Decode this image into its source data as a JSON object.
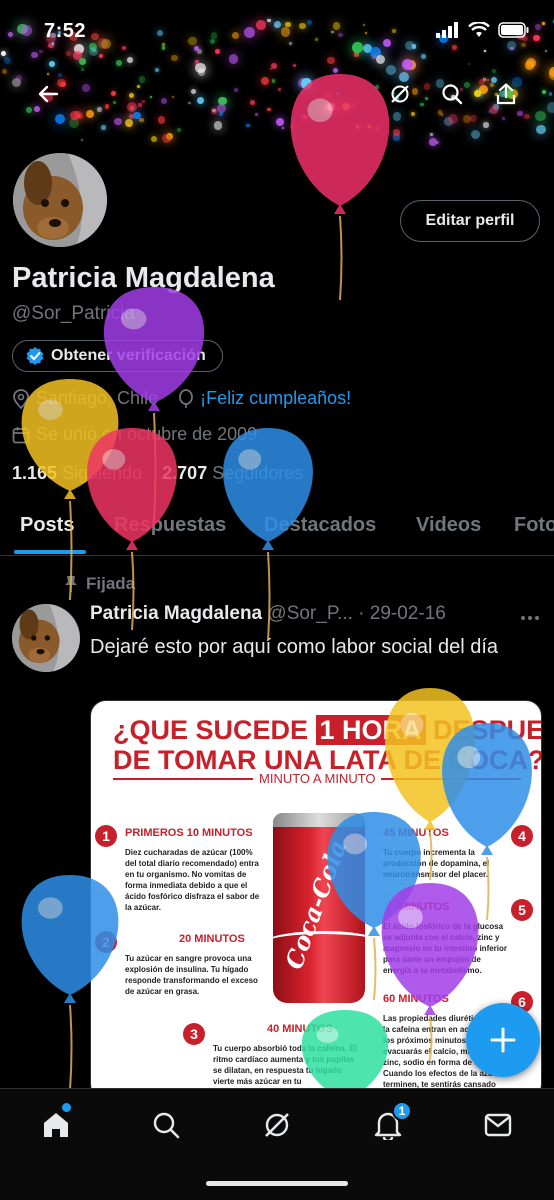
{
  "status_bar": {
    "time": "7:52"
  },
  "profile": {
    "name": "Patricia Magdalena",
    "handle": "@Sor_Patricia",
    "edit_button": "Editar perfil",
    "verify_button": "Obtener verificación",
    "location": "Santiago, Chile",
    "birthday": "¡Feliz cumpleaños!",
    "joined": "Se unió en octubre de 2009",
    "following_count": "1.165",
    "following_label": "Siguiendo",
    "followers_count": "2.707",
    "followers_label": "Seguidores"
  },
  "tabs": [
    {
      "label": "Posts",
      "active": true
    },
    {
      "label": "Respuestas",
      "active": false
    },
    {
      "label": "Destacados",
      "active": false
    },
    {
      "label": "Videos",
      "active": false
    },
    {
      "label": "Foto",
      "active": false
    }
  ],
  "pinned_tweet": {
    "pinned_label": "Fijada",
    "author_name": "Patricia Magdalena",
    "author_handle": "@Sor_P...",
    "date": "· 29-02-16",
    "text": "Dejaré esto por aquí como labor social del día",
    "image": {
      "title_line1_pre": "¿QUE SUCEDE ",
      "title_line1_highlight": "1 HORA",
      "title_line1_post": " DESPUES",
      "title_line2": "DE TOMAR UNA LATA DE COCA?",
      "subtitle": "MINUTO A MINUTO",
      "can_text": "Coca-Cola",
      "sections": [
        {
          "number": "1",
          "title": "PRIMEROS 10 MINUTOS",
          "body": "Diez cucharadas de azúcar (100% del total diario recomendado) entra en tu organismo. No vomitas de forma inmediata debido a que el ácido fosfórico disfraza el sabor de la azúcar."
        },
        {
          "number": "2",
          "title": "20 MINUTOS",
          "body": "Tu azúcar en sangre provoca una explosión de insulina. Tu hígado responde transformando el exceso de azúcar en grasa."
        },
        {
          "number": "3",
          "title": "40 MINUTOS",
          "body": "Tu cuerpo absorbió toda la cafeína. El ritmo cardíaco aumenta y tus pupilas se dilatan, en respuesta tu hígado vierte más azúcar en tu"
        },
        {
          "number": "4",
          "title": "45 MINUTOS",
          "body": "Tu cuerpo incrementa la producción de dopamina, el neurotransmisor del placer."
        },
        {
          "number": "5",
          "title": "MINUTOS",
          "body": "El ácido fosfórico de la glucosa se adjunta con el calcio, zinc y magnesio en tu intestino inferior para darte un empujón de energía a tu metabolismo."
        },
        {
          "number": "6",
          "title": "60 MINUTOS",
          "body": "Las propiedades diuréticas de la cafeína entran en acción. En los próximos minutos evacuarás el calcio, magnesio, zinc, sodio en forma de orina. Cuando los efectos de la azúcar terminen, te sentirás cansado"
        }
      ]
    }
  },
  "bottom_nav": {
    "notifications_badge": "1"
  },
  "colors": {
    "accent": "#1d9bf0",
    "background": "#000000",
    "muted": "#71767b",
    "coke_red": "#c8202b"
  },
  "icons": [
    "back-arrow-icon",
    "grok-icon",
    "search-icon",
    "share-icon",
    "verified-badge-icon",
    "location-icon",
    "balloon-icon",
    "calendar-icon",
    "pin-icon",
    "home-icon",
    "explore-icon",
    "notifications-icon",
    "messages-icon",
    "compose-plus-icon"
  ]
}
